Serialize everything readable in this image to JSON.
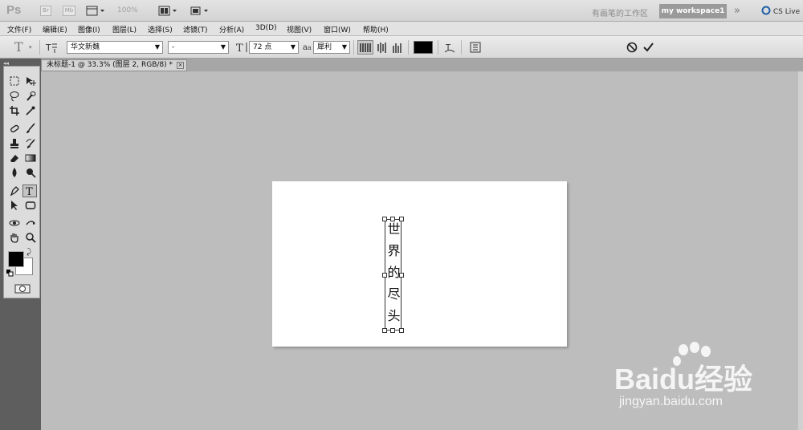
{
  "app": {
    "logo": "Ps",
    "btn_br": "Br",
    "btn_mb": "Mb",
    "zoom": "100%",
    "workspace_label": "有画笔的工作区",
    "workspace_button": "my workspace1",
    "cs_live": "CS Live"
  },
  "menu": [
    "文件(F)",
    "编辑(E)",
    "图像(I)",
    "图层(L)",
    "选择(S)",
    "滤镜(T)",
    "分析(A)",
    "3D(D)",
    "视图(V)",
    "窗口(W)",
    "帮助(H)"
  ],
  "options": {
    "tool_glyph": "T",
    "font_family": "华文新魏",
    "font_style": "-",
    "font_size": "72 点",
    "antialias": "犀利",
    "color": "#000000"
  },
  "document": {
    "tab_title": "未标题-1 @ 33.3% (图层 2, RGB/8) *",
    "close": "×",
    "text_chars": [
      "世",
      "界",
      "的",
      "尽",
      "头"
    ]
  },
  "watermark": {
    "brand": "Baidu经验",
    "url": "jingyan.baidu.com"
  },
  "icons": {
    "foreground_color": "#000000",
    "background_color": "#ffffff"
  }
}
